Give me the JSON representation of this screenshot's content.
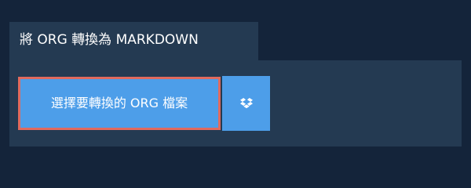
{
  "tab": {
    "title": "將 ORG 轉換為 MARKDOWN"
  },
  "actions": {
    "convert_label": "選擇要轉換的 ORG 檔案",
    "dropbox_icon": "dropbox-icon"
  },
  "colors": {
    "background": "#14243a",
    "panel": "#243a52",
    "button": "#4d9ee9",
    "button_focus_border": "#e06a5e",
    "text": "#ffffff"
  }
}
